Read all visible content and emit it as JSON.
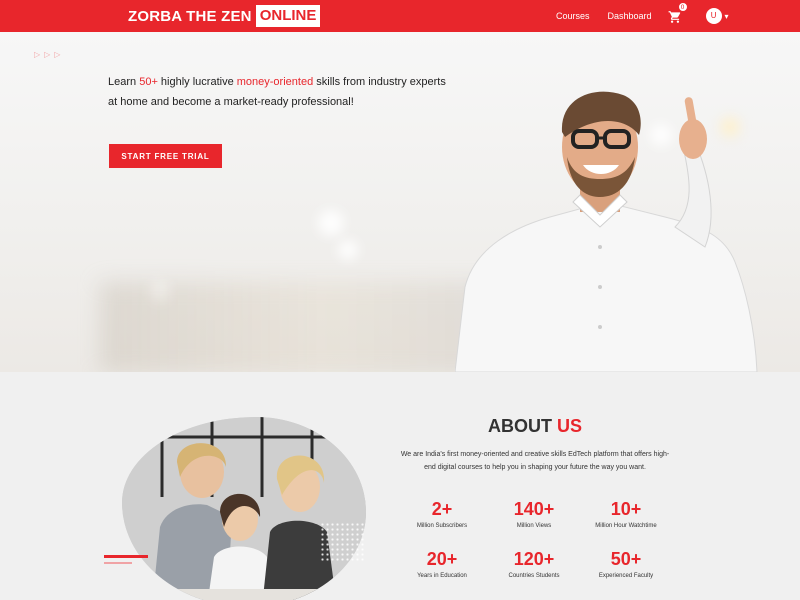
{
  "header": {
    "logo_text": "ZORBA THE ZEN",
    "logo_box": "ONLINE",
    "nav": [
      {
        "label": "Courses"
      },
      {
        "label": "Dashboard"
      }
    ],
    "cart_count": "0",
    "user_initial": "U",
    "icons": [
      "cart-icon",
      "chevron-down-icon"
    ]
  },
  "hero": {
    "text_before": "Learn ",
    "accent_count": "50+",
    "text_mid": " highly lucrative ",
    "accent_phrase": "money-oriented",
    "text_after": " skills from industry experts at home and become a market-ready professional!",
    "cta_label": "START FREE TRIAL"
  },
  "about": {
    "title_part1": "ABOUT",
    "title_part2": "US",
    "description": "We are India's first money-oriented and creative skills EdTech platform that offers high-end digital courses to help you in shaping your future the way you want.",
    "stats": [
      {
        "value": "2+",
        "label": "Million Subscribers"
      },
      {
        "value": "140+",
        "label": "Million Views"
      },
      {
        "value": "10+",
        "label": "Million Hour Watchtime"
      },
      {
        "value": "20+",
        "label": "Years in Education"
      },
      {
        "value": "120+",
        "label": "Countries Students"
      },
      {
        "value": "50+",
        "label": "Experienced Faculty"
      }
    ]
  },
  "colors": {
    "brand_red": "#e8262c",
    "section_gray": "#f0f0f0"
  }
}
